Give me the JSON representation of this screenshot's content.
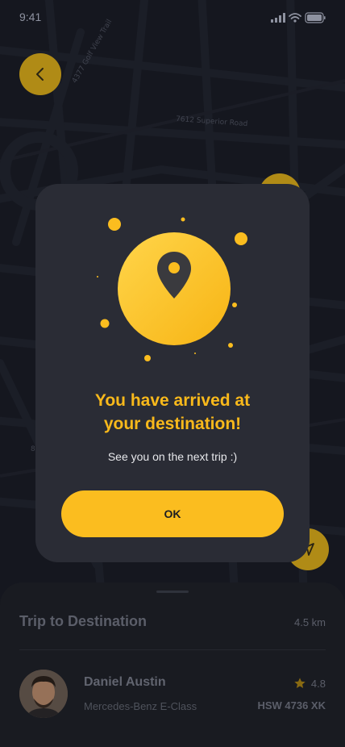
{
  "status_bar": {
    "time": "9:41"
  },
  "map": {
    "street_1": "4377 Golf View Trail",
    "street_2": "7612 Superior Road",
    "street_3": "8"
  },
  "modal": {
    "title_line_1": "You have arrived at",
    "title_line_2": "your destination!",
    "subtitle": "See you on the next trip :)",
    "ok_label": "OK",
    "icon": "location-pin-icon"
  },
  "sheet": {
    "title": "Trip to Destination",
    "distance": "4.5 km",
    "driver": {
      "name": "Daniel Austin",
      "car": "Mercedes-Benz E-Class",
      "rating": "4.8",
      "plate": "HSW 4736 XK"
    }
  },
  "colors": {
    "accent": "#fbbd1f",
    "background": "#1d2029",
    "card": "#2a2c35"
  }
}
